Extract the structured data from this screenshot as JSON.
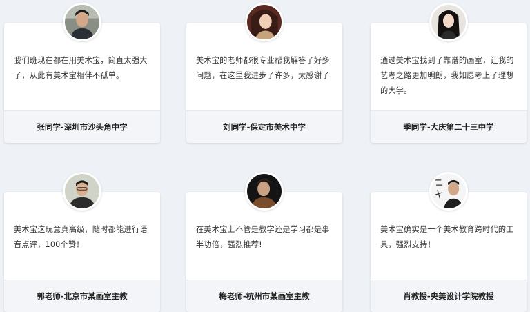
{
  "testimonials": [
    {
      "quote": "我们班现在都在用美术宝，简直太强大了，从此有美术宝相伴不孤单。",
      "author": "张同学-深圳市沙头角中学",
      "avatar_icon": "student-boy-avatar"
    },
    {
      "quote": "美术宝的老师都很专业帮我解答了好多问题，在这里我进步了许多，太感谢了",
      "author": "刘同学-保定市美术中学",
      "avatar_icon": "student-girl-avatar"
    },
    {
      "quote": "通过美术宝找到了靠谱的画室，让我的艺考之路更加明朗，我如愿考上了理想的大学。",
      "author": "季同学-大庆第二十三中学",
      "avatar_icon": "student-girl-avatar"
    },
    {
      "quote": "美术宝这玩意真高级，随时都能进行语音点评，100个赞！",
      "author": "郭老师-北京市某画室主教",
      "avatar_icon": "teacher-avatar"
    },
    {
      "quote": "在美术宝上不管是教学还是学习都是事半功倍，强烈推荐!",
      "author": "梅老师-杭州市某画室主教",
      "avatar_icon": "teacher-avatar"
    },
    {
      "quote": "美术宝确实是一个美术教育跨时代的工具，强烈支持！",
      "author": "肖教授-央美设计学院教授",
      "avatar_icon": "professor-avatar"
    }
  ]
}
